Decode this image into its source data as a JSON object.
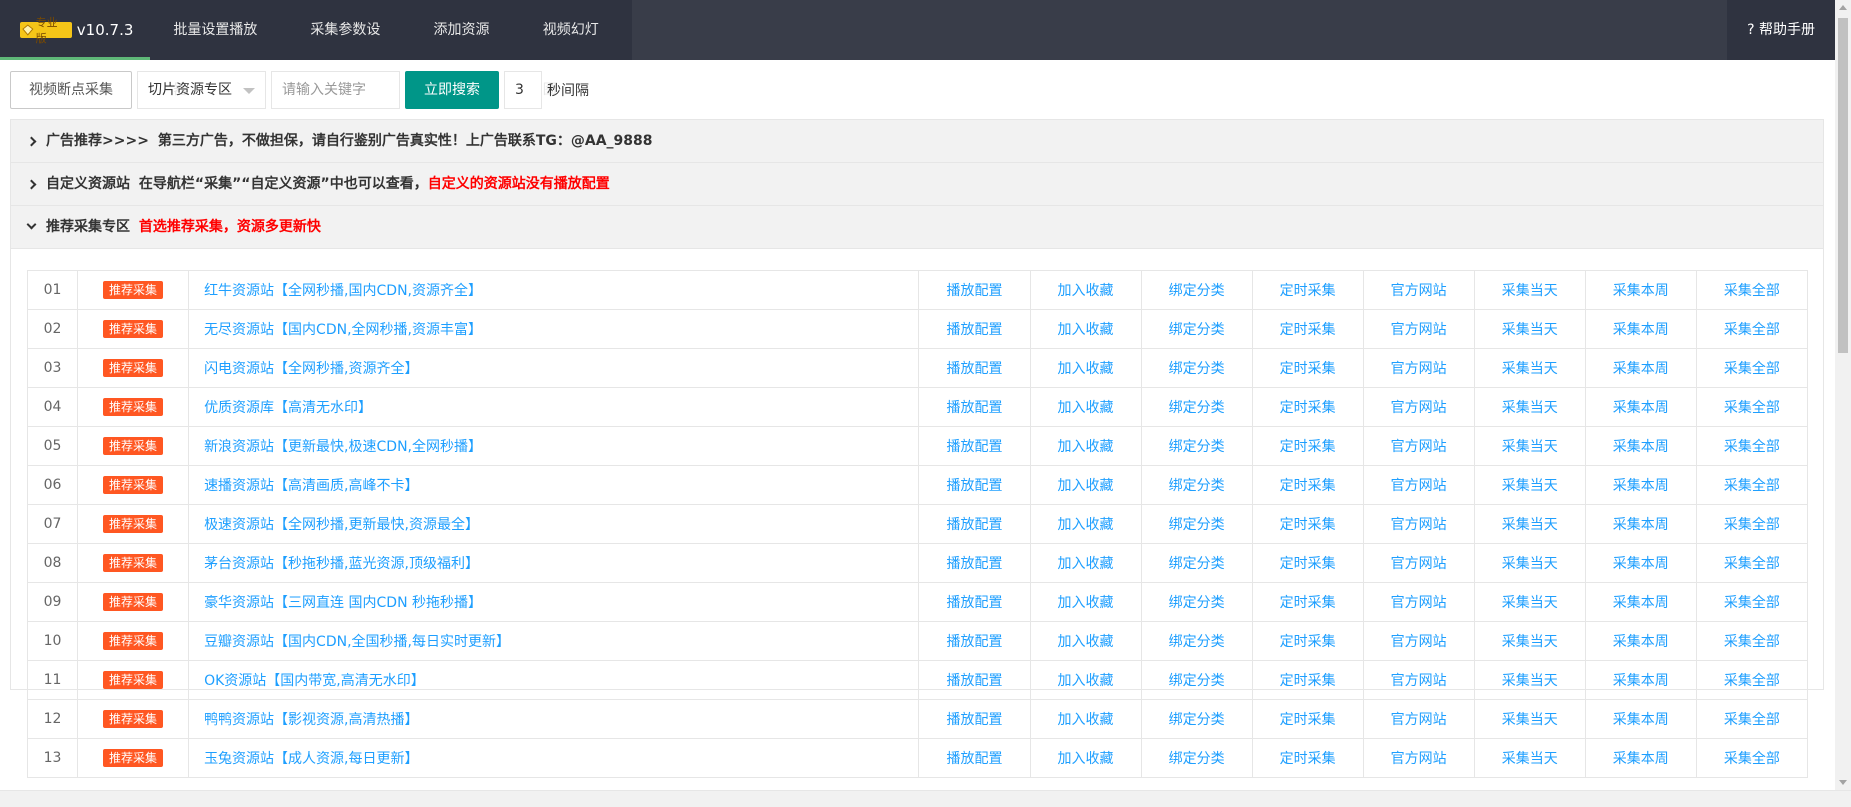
{
  "nav": {
    "badge": "专业版",
    "version": "v10.7.3",
    "items": [
      "批量设置播放器",
      "采集参数设置",
      "添加资源站",
      "视频幻灯图"
    ],
    "help": "? 帮助手册"
  },
  "toolbar": {
    "resume_button": "视频断点采集",
    "select_value": "切片资源专区",
    "search_placeholder": "请输入关键字",
    "search_button": "立即搜索",
    "interval_value": "3",
    "interval_label": "秒间隔"
  },
  "panels": {
    "ad": {
      "title": "广告推荐>>>>",
      "text": "第三方广告，不做担保，请自行鉴别广告真实性！上广告联系TG：@AA_9888"
    },
    "custom": {
      "title": "自定义资源站",
      "text": "在导航栏“采集”“自定义资源”中也可以查看，",
      "warn": "自定义的资源站没有播放配置"
    },
    "recommend": {
      "title": "推荐采集专区",
      "warn": "首选推荐采集，资源多更新快"
    }
  },
  "table": {
    "tag": "推荐采集",
    "actions": [
      "播放配置",
      "加入收藏",
      "绑定分类",
      "定时采集",
      "官方网站",
      "采集当天",
      "采集本周",
      "采集全部"
    ],
    "rows": [
      {
        "num": "01",
        "name": "红牛资源站【全网秒播,国内CDN,资源齐全】"
      },
      {
        "num": "02",
        "name": "无尽资源站【国内CDN,全网秒播,资源丰富】"
      },
      {
        "num": "03",
        "name": "闪电资源站【全网秒播,资源齐全】"
      },
      {
        "num": "04",
        "name": "优质资源库【高清无水印】"
      },
      {
        "num": "05",
        "name": "新浪资源站【更新最快,极速CDN,全网秒播】"
      },
      {
        "num": "06",
        "name": "速播资源站【高清画质,高峰不卡】"
      },
      {
        "num": "07",
        "name": "极速资源站【全网秒播,更新最快,资源最全】"
      },
      {
        "num": "08",
        "name": "茅台资源站【秒拖秒播,蓝光资源,顶级福利】"
      },
      {
        "num": "09",
        "name": "豪华资源站【三网直连 国内CDN 秒拖秒播】"
      },
      {
        "num": "10",
        "name": "豆瓣资源站【国内CDN,全国秒播,每日实时更新】"
      },
      {
        "num": "11",
        "name": "OK资源站【国内带宽,高清无水印】"
      },
      {
        "num": "12",
        "name": "鸭鸭资源站【影视资源,高清热播】"
      },
      {
        "num": "13",
        "name": "玉兔资源站【成人资源,每日更新】"
      }
    ]
  }
}
